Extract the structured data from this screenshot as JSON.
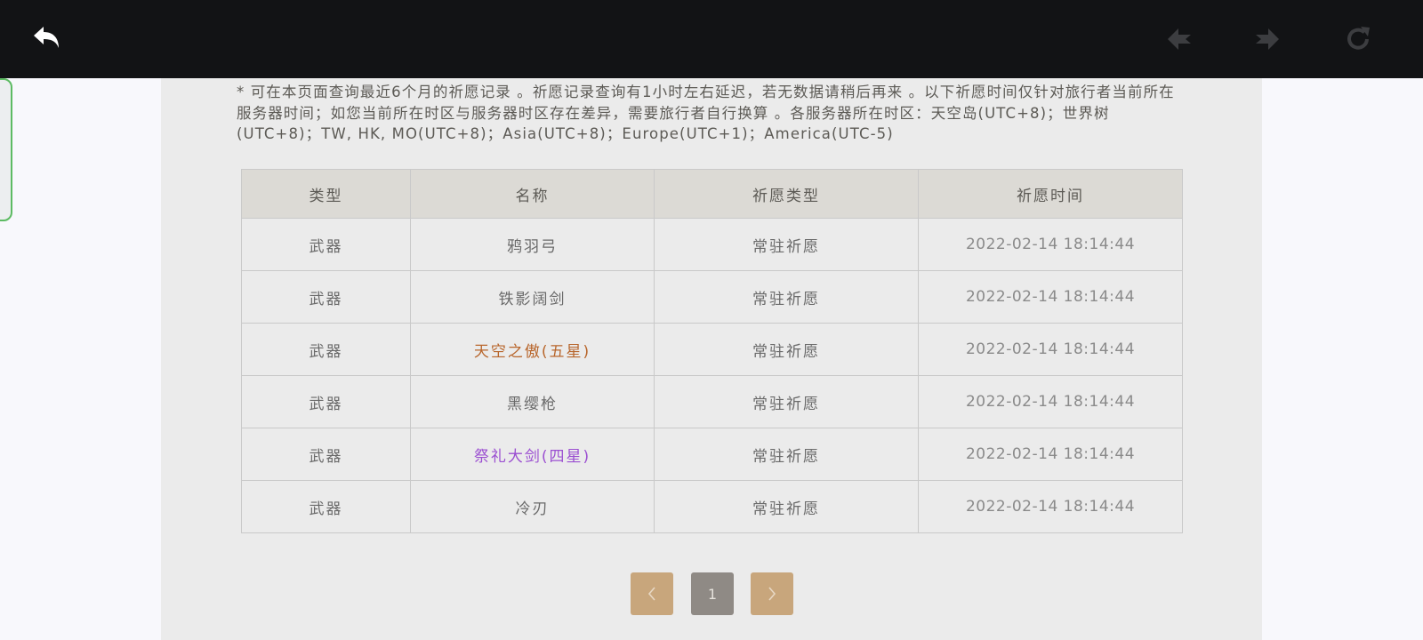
{
  "colors": {
    "topbar": "#121315",
    "panel": "#ebebeb",
    "header_row": "#dcdad5",
    "five_star": "#b8662c",
    "four_star": "#9b4fd1",
    "pager_arrow": "#c8a67c",
    "pager_current": "#8f8a85"
  },
  "toolbar": {
    "back_icon": "undo-arrow-icon",
    "prev_icon": "nav-prev-icon",
    "next_icon": "nav-next-icon",
    "reload_icon": "reload-icon"
  },
  "notice": "* 可在本页面查询最近6个月的祈愿记录 。祈愿记录查询有1小时左右延迟，若无数据请稍后再来 。以下祈愿时间仅针对旅行者当前所在服务器时间；如您当前所在时区与服务器时区存在差异，需要旅行者自行换算 。各服务器所在时区：天空岛(UTC+8)；世界树(UTC+8)；TW, HK, MO(UTC+8)；Asia(UTC+8)；Europe(UTC+1)；America(UTC-5)",
  "table": {
    "headers": [
      "类型",
      "名称",
      "祈愿类型",
      "祈愿时间"
    ],
    "rows": [
      {
        "type": "武器",
        "name": "鸦羽弓",
        "wish_type": "常驻祈愿",
        "time": "2022-02-14 18:14:44",
        "rarity": 3
      },
      {
        "type": "武器",
        "name": "铁影阔剑",
        "wish_type": "常驻祈愿",
        "time": "2022-02-14 18:14:44",
        "rarity": 3
      },
      {
        "type": "武器",
        "name": "天空之傲(五星)",
        "wish_type": "常驻祈愿",
        "time": "2022-02-14 18:14:44",
        "rarity": 5
      },
      {
        "type": "武器",
        "name": "黑缨枪",
        "wish_type": "常驻祈愿",
        "time": "2022-02-14 18:14:44",
        "rarity": 3
      },
      {
        "type": "武器",
        "name": "祭礼大剑(四星)",
        "wish_type": "常驻祈愿",
        "time": "2022-02-14 18:14:44",
        "rarity": 4
      },
      {
        "type": "武器",
        "name": "冷刃",
        "wish_type": "常驻祈愿",
        "time": "2022-02-14 18:14:44",
        "rarity": 3
      }
    ]
  },
  "pagination": {
    "prev_icon": "chevron-left-icon",
    "current_page": "1",
    "next_icon": "chevron-right-icon"
  }
}
